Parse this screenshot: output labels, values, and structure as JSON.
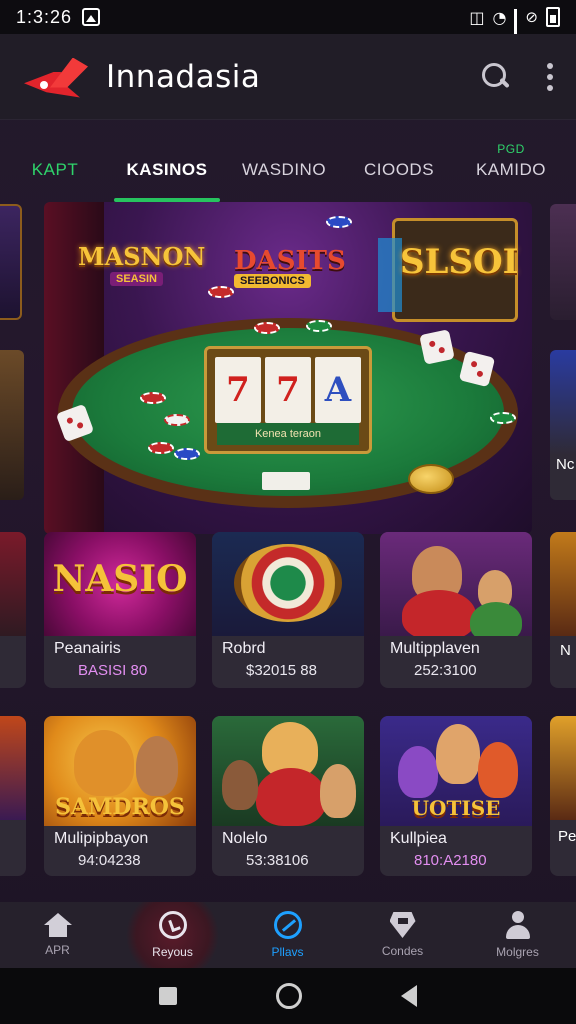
{
  "status_bar": {
    "time": "1:3:26",
    "icons": [
      "image-icon",
      "vibrate-icon",
      "wifi-icon",
      "signal-icon",
      "no-signal-icon",
      "battery-icon"
    ]
  },
  "app_bar": {
    "title": "Innadasia",
    "logo": "red-bird-logo",
    "actions": [
      "search-icon",
      "more-vert-icon"
    ]
  },
  "tabs": [
    {
      "label": "KAPT",
      "style": "green"
    },
    {
      "label": "KASINOS",
      "style": "active"
    },
    {
      "label": "WASDINO",
      "style": "normal"
    },
    {
      "label": "CIOODS",
      "style": "normal"
    },
    {
      "label": "KAMIDO",
      "style": "normal",
      "badge": "PGD"
    }
  ],
  "hero": {
    "title_left": "MASNON",
    "title_left_sub": "SEASIN",
    "title_center": "DASITS",
    "title_center_sub": "SEEBONICS",
    "title_right": "SLSOI",
    "slot_plate": "Kenea teraon",
    "reels": [
      "7",
      "7",
      "A"
    ]
  },
  "games": [
    {
      "name": "Peanairis",
      "meta": "BASISI 80",
      "art_title": "NASIO",
      "meta_color": "pink"
    },
    {
      "name": "Robrd",
      "meta": "$32015 88",
      "art_title": "",
      "meta_color": "white"
    },
    {
      "name": "Multipplaven",
      "meta": "252:3100",
      "art_title": "",
      "meta_color": "white"
    },
    {
      "name": "Mulipipbayon",
      "meta": "94:04238",
      "art_title": "SAMDROS",
      "meta_color": "white"
    },
    {
      "name": "Nolelo",
      "meta": "53:38106",
      "art_title": "",
      "meta_color": "white"
    },
    {
      "name": "Kullpiea",
      "meta": "810:A2180",
      "art_title": "UOTISE",
      "meta_color": "pink"
    }
  ],
  "edge_labels": {
    "right_row1": "Nc",
    "right_row2": "N",
    "right_row3": "Pe"
  },
  "bottom_nav": [
    {
      "label": "APR",
      "icon": "home-icon"
    },
    {
      "label": "Reyous",
      "icon": "recent-icon"
    },
    {
      "label": "Pllavs",
      "icon": "play-icon"
    },
    {
      "label": "Condes",
      "icon": "gift-icon"
    },
    {
      "label": "Molgres",
      "icon": "user-icon"
    }
  ],
  "colors": {
    "accent_green": "#27c35f",
    "accent_blue": "#1ea0ff",
    "brand_red": "#e2242c",
    "background": "#221a2a"
  }
}
